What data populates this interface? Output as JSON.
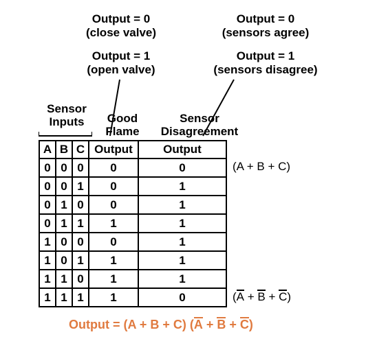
{
  "annotations": {
    "left_top": {
      "l1": "Output = 0",
      "l2": "(close valve)"
    },
    "right_top": {
      "l1": "Output = 0",
      "l2": "(sensors agree)"
    },
    "left_bot": {
      "l1": "Output = 1",
      "l2": "(open valve)"
    },
    "right_bot": {
      "l1": "Output = 1",
      "l2": "(sensors disagree)"
    }
  },
  "colheads": {
    "sensor_inputs": "Sensor\nInputs",
    "good_flame": "Good\nFlame",
    "sensor_dis": "Sensor\nDisagreement"
  },
  "table": {
    "headers": {
      "a": "A",
      "b": "B",
      "c": "C",
      "out1": "Output",
      "out2": "Output"
    },
    "rows": [
      {
        "a": "0",
        "b": "0",
        "c": "0",
        "out1": "0",
        "out2": "0"
      },
      {
        "a": "0",
        "b": "0",
        "c": "1",
        "out1": "0",
        "out2": "1"
      },
      {
        "a": "0",
        "b": "1",
        "c": "0",
        "out1": "0",
        "out2": "1"
      },
      {
        "a": "0",
        "b": "1",
        "c": "1",
        "out1": "1",
        "out2": "1"
      },
      {
        "a": "1",
        "b": "0",
        "c": "0",
        "out1": "0",
        "out2": "1"
      },
      {
        "a": "1",
        "b": "0",
        "c": "1",
        "out1": "1",
        "out2": "1"
      },
      {
        "a": "1",
        "b": "1",
        "c": "0",
        "out1": "1",
        "out2": "1"
      },
      {
        "a": "1",
        "b": "1",
        "c": "1",
        "out1": "1",
        "out2": "0"
      }
    ]
  },
  "side": {
    "top": {
      "before": "(A + B + C)"
    },
    "bot_parts": {
      "open": "(",
      "a": "A",
      "sep1": " + ",
      "b": "B",
      "sep2": " + ",
      "c": "C",
      "close": ")"
    }
  },
  "equation": {
    "lhs": "Output = ",
    "g1": "(A + B + C)",
    "space": " ",
    "g2_parts": {
      "open": "(",
      "a": "A",
      "sep1": " + ",
      "b": "B",
      "sep2": " + ",
      "c": "C",
      "close": ")"
    }
  },
  "chart_data": {
    "type": "table",
    "title": "Truth table: Good-Flame output and Sensor-Disagreement output vs. sensor inputs A,B,C",
    "columns": [
      "A",
      "B",
      "C",
      "Good Flame Output",
      "Sensor Disagreement Output"
    ],
    "rows": [
      [
        0,
        0,
        0,
        0,
        0
      ],
      [
        0,
        0,
        1,
        0,
        1
      ],
      [
        0,
        1,
        0,
        0,
        1
      ],
      [
        0,
        1,
        1,
        1,
        1
      ],
      [
        1,
        0,
        0,
        0,
        1
      ],
      [
        1,
        0,
        1,
        1,
        1
      ],
      [
        1,
        1,
        0,
        1,
        1
      ],
      [
        1,
        1,
        1,
        1,
        0
      ]
    ],
    "annotations": {
      "good_flame_output_meaning": {
        "0": "close valve",
        "1": "open valve"
      },
      "disagreement_output_meaning": {
        "0": "sensors agree",
        "1": "sensors disagree"
      },
      "row0_pos_term": "(A + B + C)",
      "row7_pos_term": "(A' + B' + C')",
      "disagreement_output_expression": "Output = (A + B + C)(A' + B' + C')"
    }
  }
}
